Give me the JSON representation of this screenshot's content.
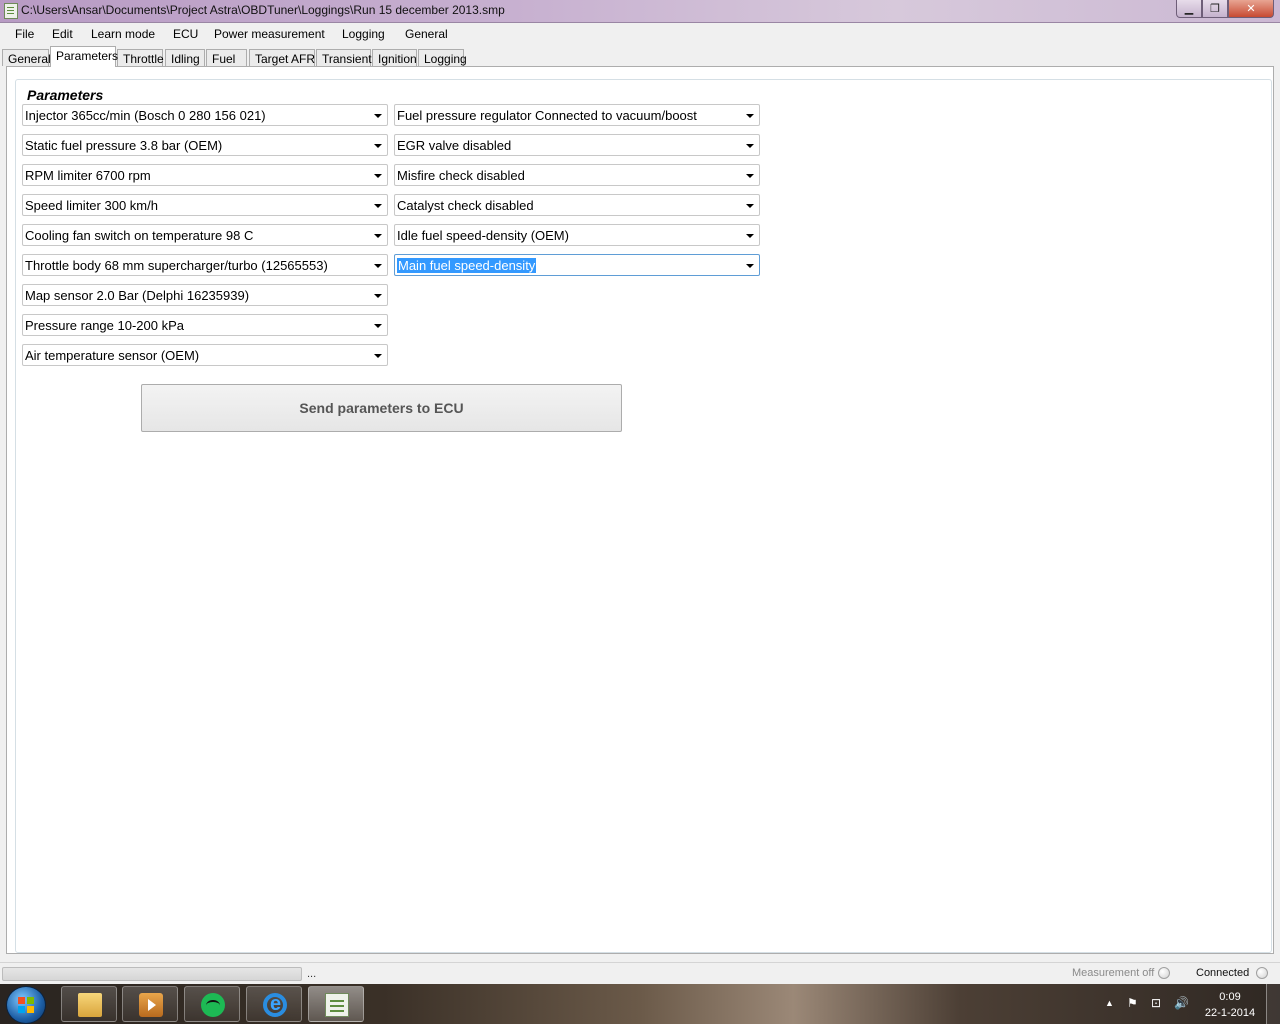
{
  "window": {
    "title": "C:\\Users\\Ansar\\Documents\\Project Astra\\OBDTuner\\Loggings\\Run 15 december 2013.smp",
    "minimize_glyph": "▁",
    "maximize_glyph": "❐",
    "close_glyph": "✕"
  },
  "menu": [
    "File",
    "Edit",
    "Learn mode",
    "ECU",
    "Power measurement",
    "Logging",
    "General"
  ],
  "tabs": [
    "General",
    "Parameters",
    "Throttle",
    "Idling",
    "Fuel",
    "Target AFR",
    "Transient",
    "Ignition",
    "Logging"
  ],
  "active_tab": "Parameters",
  "parameters": {
    "group_title": "Parameters",
    "left_column": [
      "Injector 365cc/min (Bosch 0 280 156 021)",
      "Static fuel pressure 3.8 bar (OEM)",
      "RPM limiter 6700 rpm",
      "Speed limiter 300 km/h",
      "Cooling fan switch on temperature 98 C",
      "Throttle body 68 mm supercharger/turbo (12565553)",
      "Map sensor 2.0 Bar (Delphi 16235939)",
      "Pressure range  10-200 kPa",
      "Air temperature sensor (OEM)"
    ],
    "right_column": [
      "Fuel pressure regulator Connected to vacuum/boost",
      "EGR valve disabled",
      "Misfire check disabled",
      "Catalyst check disabled",
      "Idle fuel speed-density (OEM)",
      "Main fuel speed-density"
    ],
    "send_button": "Send parameters to ECU"
  },
  "status": {
    "ellipsis": "...",
    "measurement": "Measurement off",
    "connection": "Connected"
  },
  "taskbar": {
    "apps": [
      "windows-explorer",
      "media-player",
      "spotify",
      "internet-explorer",
      "obdtuner"
    ],
    "tray": {
      "show_hidden_glyph": "▲",
      "flag_glyph": "⚑",
      "network_glyph": "⊡",
      "volume_glyph": "🔊"
    },
    "time": "0:09",
    "date": "22-1-2014"
  }
}
